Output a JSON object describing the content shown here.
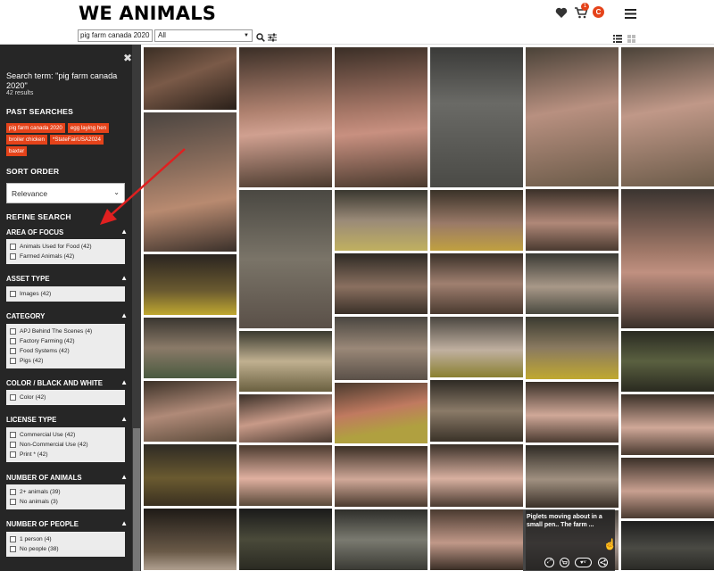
{
  "header": {
    "logo": "WE ANIMALS",
    "cart_count": "1",
    "avatar_letter": "C"
  },
  "search": {
    "value": "pig farm canada 2020",
    "select_value": "All"
  },
  "sidebar": {
    "search_term": "Search term: \"pig farm canada 2020\"",
    "results": "42 results",
    "past_searches_title": "PAST SEARCHES",
    "past_searches": [
      "pig farm canada 2020",
      "egg laying hen",
      "broiler chicken",
      "*StateFairUSA2024",
      "baxter"
    ],
    "sort_title": "SORT ORDER",
    "sort_value": "Relevance",
    "refine_title": "REFINE SEARCH",
    "facets": [
      {
        "title": "AREA OF FOCUS",
        "options": [
          "Animals Used for Food (42)",
          "Farmed Animals (42)"
        ]
      },
      {
        "title": "ASSET TYPE",
        "options": [
          "Images (42)"
        ]
      },
      {
        "title": "CATEGORY",
        "options": [
          "APJ Behind The Scenes (4)",
          "Factory Farming (42)",
          "Food Systems (42)",
          "Pigs (42)"
        ]
      },
      {
        "title": "COLOR / BLACK AND WHITE",
        "options": [
          "Color (42)"
        ]
      },
      {
        "title": "LICENSE TYPE",
        "options": [
          "Commercial Use (42)",
          "Non-Commercial Use (42)",
          "Print * (42)"
        ]
      },
      {
        "title": "NUMBER OF ANIMALS",
        "options": [
          "2+ animals (39)",
          "No animals (3)"
        ]
      },
      {
        "title": "NUMBER OF PEOPLE",
        "options": [
          "1 person (4)",
          "No people (38)"
        ]
      }
    ]
  },
  "hover_card": {
    "caption": "Piglets moving about in a small pen.. The farm ..."
  },
  "colors": {
    "accent": "#e5431a",
    "sidebar_bg": "#262626",
    "arrow": "#e02020"
  },
  "icons": [
    "heart-icon",
    "cart-icon",
    "menu-icon",
    "search-icon",
    "filter-icon",
    "list-view-icon",
    "grid-view-icon",
    "close-icon"
  ]
}
